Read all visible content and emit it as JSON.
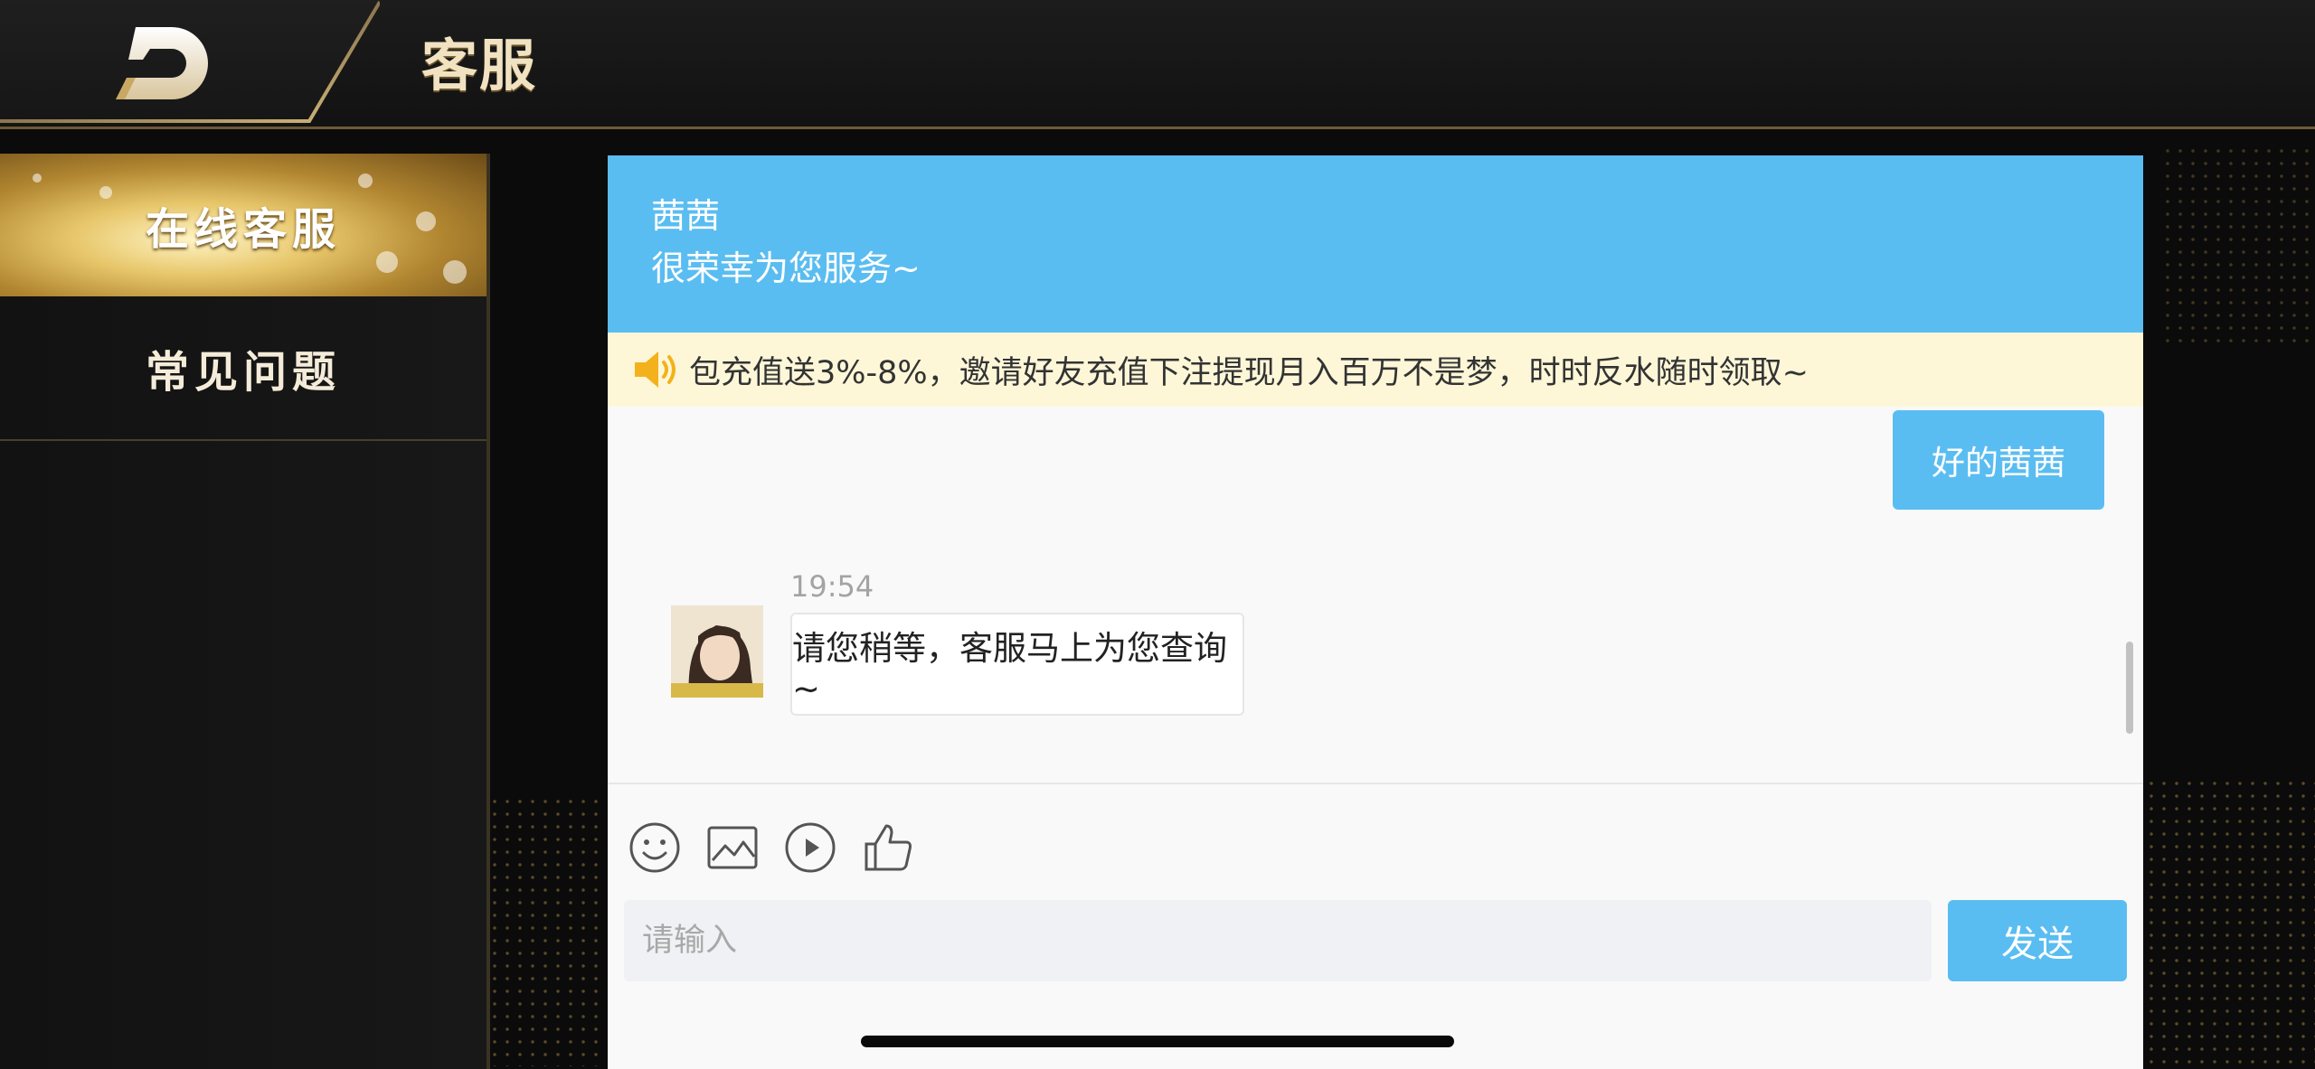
{
  "header": {
    "title": "客服",
    "back_icon": "back-arrow-icon"
  },
  "sidebar": {
    "items": [
      {
        "label": "在线客服",
        "active": true
      },
      {
        "label": "常见问题",
        "active": false
      }
    ]
  },
  "chat": {
    "agent_name": "茜茜",
    "agent_greeting": "很荣幸为您服务~",
    "notice": "包充值送3%-8%，邀请好友充值下注提现月入百万不是梦，时时反水随时领取~",
    "messages": [
      {
        "from": "user",
        "text": "好的茜茜"
      },
      {
        "from": "agent",
        "time": "19:54",
        "text": "请您稍等，客服马上为您查询~"
      }
    ],
    "toolbar": [
      {
        "icon": "emoji-icon"
      },
      {
        "icon": "image-icon"
      },
      {
        "icon": "video-play-icon"
      },
      {
        "icon": "thumbs-up-icon"
      }
    ],
    "input_placeholder": "请输入",
    "input_value": "",
    "send_label": "发送"
  },
  "colors": {
    "accent": "#5abdf1",
    "notice_bg": "#fdf7d8",
    "gold": "#e7c66a"
  }
}
